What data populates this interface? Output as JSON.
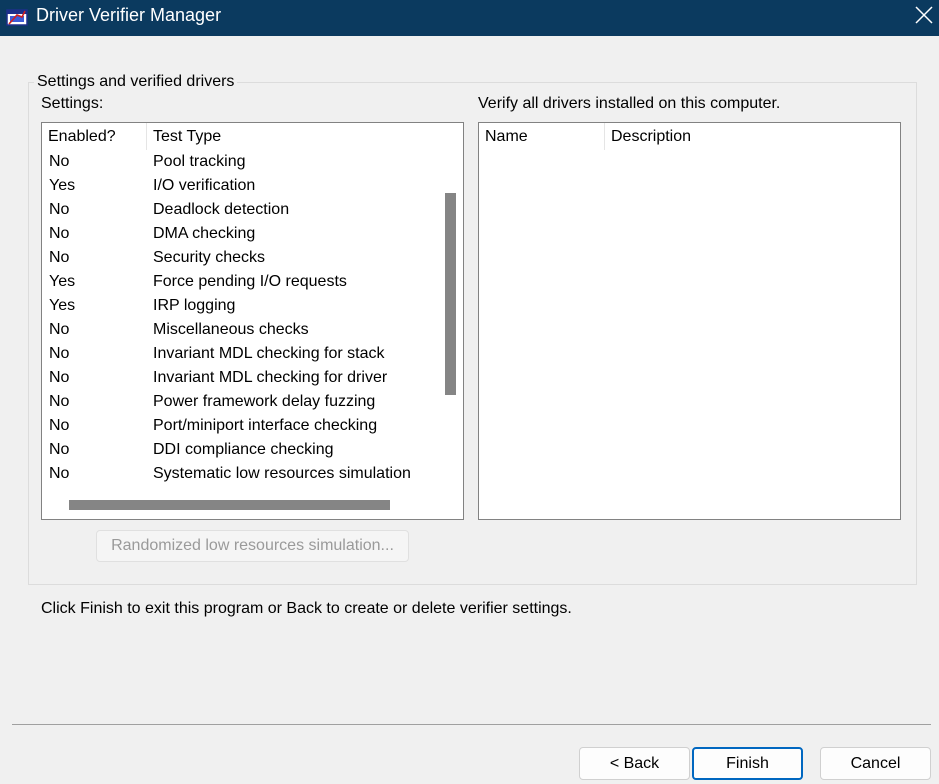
{
  "window": {
    "title": "Driver Verifier Manager",
    "icon": "driver-verifier-app-icon",
    "close_icon": "close-icon"
  },
  "group": {
    "legend": "Settings and verified drivers"
  },
  "settings": {
    "label": "Settings:",
    "columns": [
      "Enabled?",
      "Test Type"
    ],
    "rows": [
      {
        "enabled": "No",
        "test": "Pool tracking"
      },
      {
        "enabled": "Yes",
        "test": "I/O verification"
      },
      {
        "enabled": "No",
        "test": "Deadlock detection"
      },
      {
        "enabled": "No",
        "test": "DMA checking"
      },
      {
        "enabled": "No",
        "test": "Security checks"
      },
      {
        "enabled": "Yes",
        "test": "Force pending I/O requests"
      },
      {
        "enabled": "Yes",
        "test": "IRP logging"
      },
      {
        "enabled": "No",
        "test": "Miscellaneous checks"
      },
      {
        "enabled": "No",
        "test": "Invariant MDL checking for stack"
      },
      {
        "enabled": "No",
        "test": "Invariant MDL checking for driver"
      },
      {
        "enabled": "No",
        "test": "Power framework delay fuzzing"
      },
      {
        "enabled": "No",
        "test": "Port/miniport interface checking"
      },
      {
        "enabled": "No",
        "test": "DDI compliance checking"
      },
      {
        "enabled": "No",
        "test": "Systematic low resources simulation"
      }
    ]
  },
  "drivers": {
    "label": "Verify all drivers installed on this computer.",
    "columns": [
      "Name",
      "Description"
    ]
  },
  "randomized_button": "Randomized low resources simulation...",
  "instruction": "Click Finish to exit this program or Back to create or delete verifier settings.",
  "buttons": {
    "back": "< Back",
    "finish": "Finish",
    "cancel": "Cancel"
  },
  "colors": {
    "titlebar": "#0b3a5f",
    "accent": "#0067c0"
  }
}
